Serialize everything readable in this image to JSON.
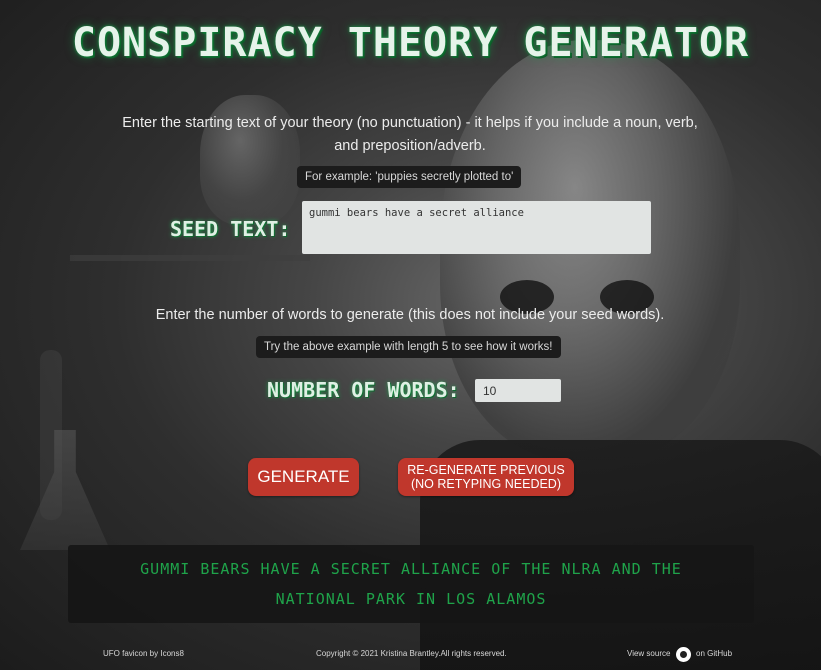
{
  "title": "CONSPIRACY THEORY GENERATOR",
  "instructions": {
    "seed": "Enter the starting text of your theory (no punctuation) - it helps if you include a noun, verb, and preposition/adverb.",
    "words": "Enter the number of words to generate (this does not include your seed words)."
  },
  "tips": {
    "seed_example": "For example: 'puppies secretly plotted to'",
    "words_example": "Try the above example with length 5 to see how it works!"
  },
  "form": {
    "seed_label": "SEED TEXT:",
    "seed_value": "gummi bears have a secret alliance",
    "words_label": "NUMBER OF WORDS:",
    "words_value": "10"
  },
  "buttons": {
    "generate": "GENERATE",
    "regenerate": "RE-GENERATE PREVIOUS\n(NO RETYPING NEEDED)"
  },
  "output": "GUMMI BEARS HAVE A SECRET ALLIANCE OF THE NLRA AND THE NATIONAL PARK IN LOS ALAMOS",
  "footer": {
    "favicon_credit": "UFO favicon by Icons8",
    "copyright": "Copyright © 2021 Kristina Brantley.All rights reserved.",
    "view_source": "View source",
    "github": "on GitHub"
  },
  "colors": {
    "accent_green": "#1fa34a",
    "button_red": "#c0372c"
  }
}
